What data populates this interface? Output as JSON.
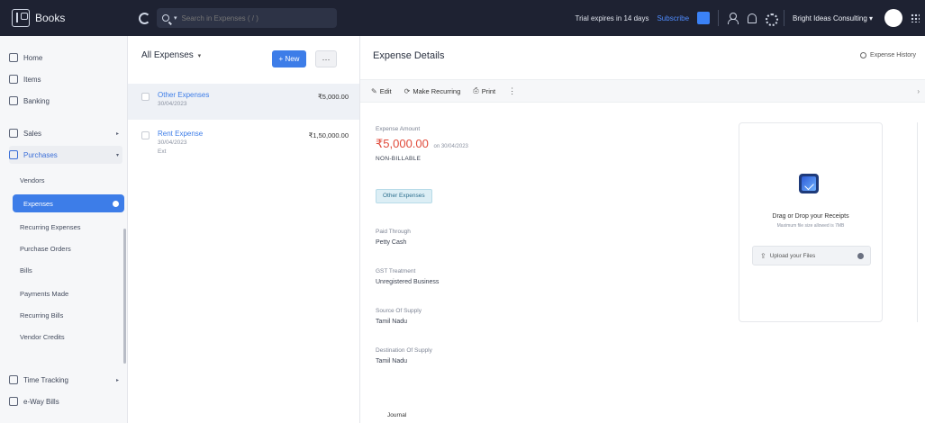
{
  "topbar": {
    "brand": "Books",
    "search_placeholder": "Search in Expenses ( / )",
    "trial_text": "Trial expires in 14 days",
    "subscribe_label": "Subscribe",
    "org_name": "Bright Ideas Consulting ▾"
  },
  "sidebar": {
    "items": [
      {
        "label": "Home"
      },
      {
        "label": "Items"
      },
      {
        "label": "Banking"
      },
      {
        "label": "Sales"
      },
      {
        "label": "Purchases"
      }
    ],
    "purchases_sub": [
      {
        "label": "Vendors"
      },
      {
        "label": "Expenses"
      },
      {
        "label": "Recurring Expenses"
      },
      {
        "label": "Purchase Orders"
      },
      {
        "label": "Bills"
      },
      {
        "label": "Payments Made"
      },
      {
        "label": "Recurring Bills"
      },
      {
        "label": "Vendor Credits"
      }
    ],
    "bottom_items": [
      {
        "label": "Time Tracking"
      },
      {
        "label": "e-Way Bills"
      }
    ]
  },
  "list": {
    "view_title": "All Expenses",
    "new_label": "+ New",
    "more_label": "···",
    "rows": [
      {
        "title": "Other Expenses",
        "date": "30/04/2023",
        "ref": "",
        "amount": "₹5,000.00"
      },
      {
        "title": "Rent Expense",
        "date": "30/04/2023",
        "ref": "Ext",
        "amount": "₹1,50,000.00"
      }
    ]
  },
  "detail": {
    "title": "Expense Details",
    "history_label": "Expense History",
    "toolbar": {
      "edit": "Edit",
      "recurring": "Make Recurring",
      "print": "Print"
    },
    "amount_label": "Expense Amount",
    "amount": "₹5,000.00",
    "amount_on": "on 30/04/2023",
    "billable": "NON-BILLABLE",
    "category_tag": "Other Expenses",
    "fields": [
      {
        "label": "Paid Through",
        "value": "Petty Cash"
      },
      {
        "label": "GST Treatment",
        "value": "Unregistered Business"
      },
      {
        "label": "Source Of Supply",
        "value": "Tamil Nadu"
      },
      {
        "label": "Destination Of Supply",
        "value": "Tamil Nadu"
      }
    ],
    "bottom_tab": "Journal"
  },
  "upload": {
    "title": "Drag or Drop your Receipts",
    "subtitle": "Maximum file size allowed is 7MB",
    "button_label": "Upload your Files"
  },
  "colors": {
    "topbar_bg": "#1e2232",
    "accent_blue": "#3d7de8",
    "amount_red": "#e04a3a",
    "tag_bg": "#dceef5"
  }
}
